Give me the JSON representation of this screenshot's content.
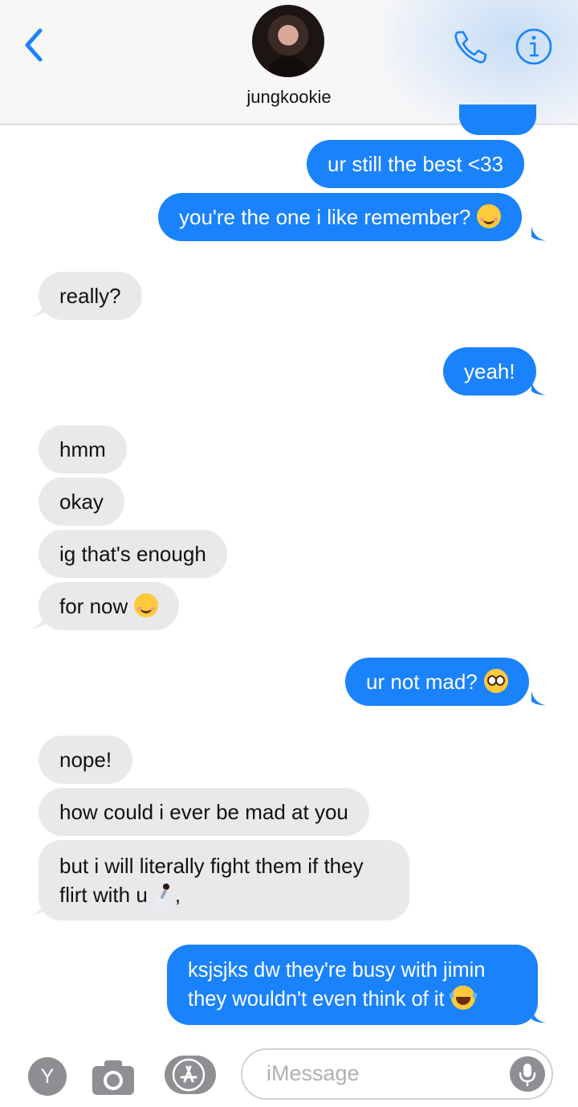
{
  "header": {
    "contact_name": "jungkookie",
    "back_icon": "chevron-left-icon",
    "call_icon": "phone-icon",
    "info_icon": "info-icon",
    "accent_color": "#1a82fb"
  },
  "messages": [
    {
      "side": "out",
      "text": "ur still the best <33"
    },
    {
      "side": "out",
      "text": "you're the one i like remember?",
      "emoji": "smiling-face-icon"
    },
    {
      "side": "in",
      "text": "really?"
    },
    {
      "side": "out",
      "text": "yeah!"
    },
    {
      "side": "in",
      "text": "hmm"
    },
    {
      "side": "in",
      "text": "okay"
    },
    {
      "side": "in",
      "text": "ig that's enough"
    },
    {
      "side": "in",
      "text": "for now",
      "emoji": "smiling-face-icon"
    },
    {
      "side": "out",
      "text": "ur not mad?",
      "emoji": "pleading-face-icon"
    },
    {
      "side": "in",
      "text": "nope!"
    },
    {
      "side": "in",
      "text": "how could i ever be mad at you"
    },
    {
      "side": "in",
      "text_line1": "but i will literally fight them if they",
      "text_line2": "flirt with u",
      "text_after": ",",
      "emoji": "person-running-icon"
    },
    {
      "side": "out",
      "text_line1": "ksjsjks dw they're busy with jimin",
      "text_line2": "they wouldn't even think of it",
      "emoji": "laughing-tears-icon"
    }
  ],
  "composer": {
    "avatar_letter": "Y",
    "placeholder": "iMessage",
    "camera_icon": "camera-icon",
    "apps_icon": "app-store-icon",
    "mic_icon": "microphone-icon"
  },
  "colors": {
    "outgoing_bubble": "#1a82fb",
    "incoming_bubble": "#e9e9eb"
  }
}
